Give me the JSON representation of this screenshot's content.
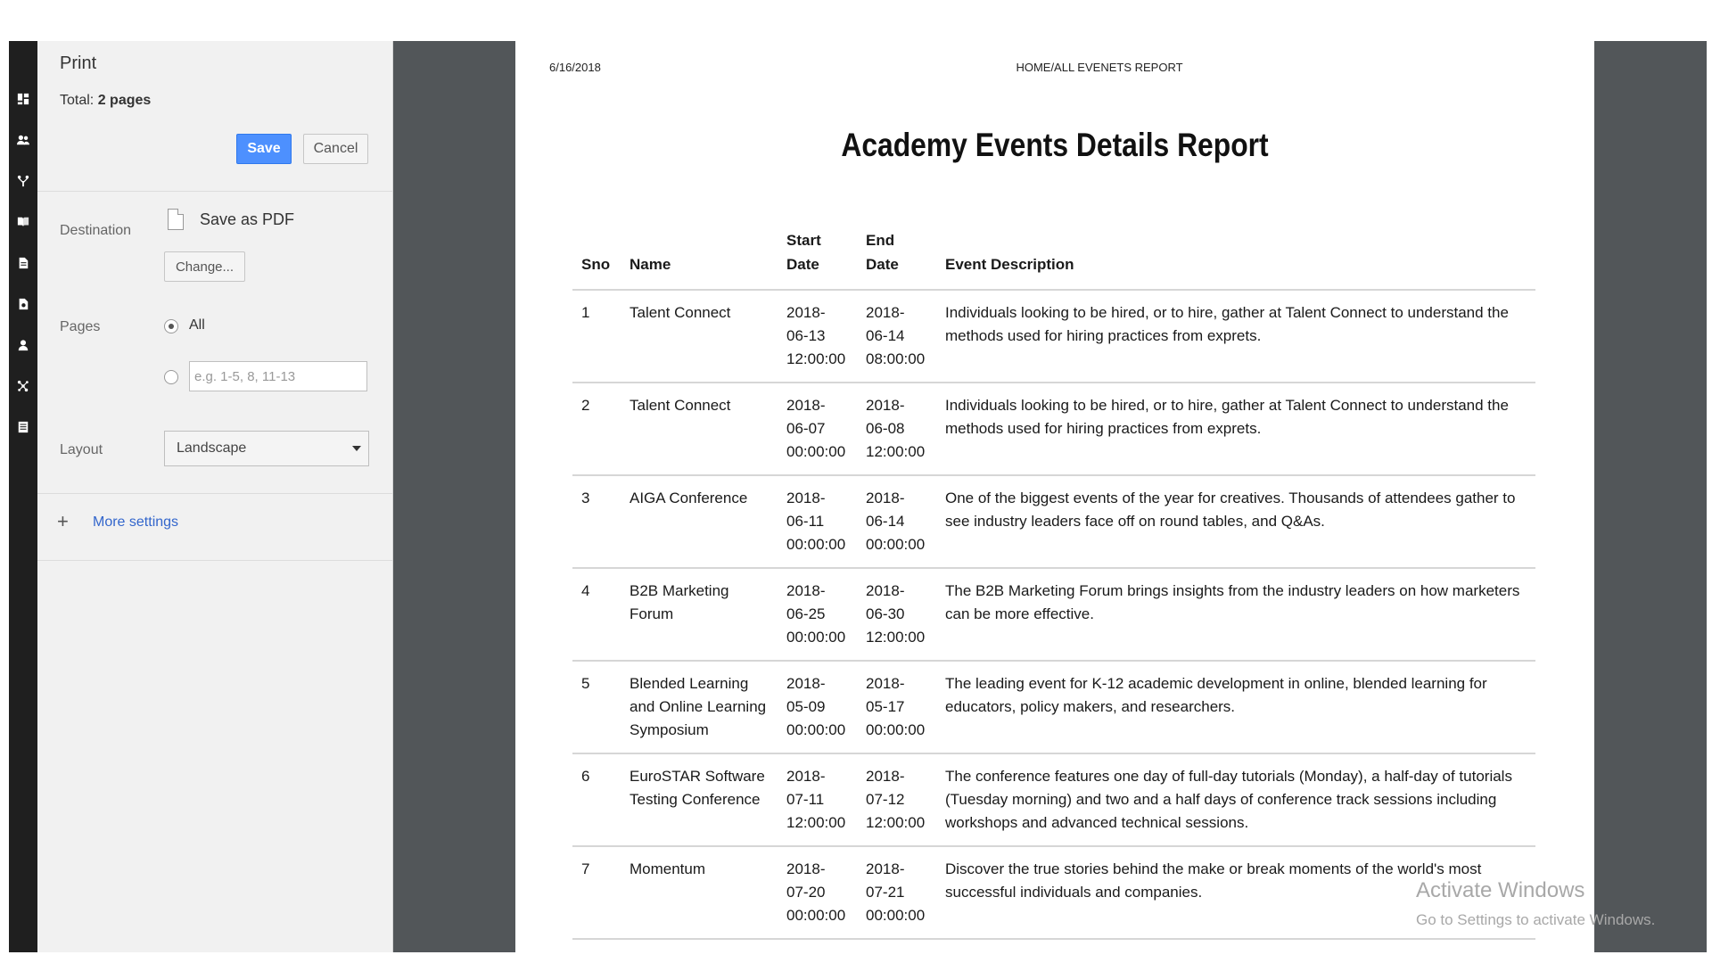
{
  "panel": {
    "title": "Print",
    "total_label": "Total:",
    "total_value": "2 pages",
    "save_label": "Save",
    "cancel_label": "Cancel",
    "destination_label": "Destination",
    "destination_value": "Save as PDF",
    "change_label": "Change...",
    "pages_label": "Pages",
    "pages_all_label": "All",
    "pages_placeholder": "e.g. 1-5, 8, 11-13",
    "layout_label": "Layout",
    "layout_value": "Landscape",
    "more_settings_label": "More settings"
  },
  "rail_icons": [
    "dashboard-icon",
    "users-icon",
    "branch-icon",
    "book-icon",
    "document-icon",
    "report-icon",
    "user-icon",
    "network-icon",
    "list-icon"
  ],
  "document": {
    "date": "6/16/2018",
    "header": "HOME/ALL EVENETS REPORT",
    "title": "Academy Events Details Report",
    "columns": {
      "sno": "Sno",
      "name": "Name",
      "start_line1": "Start",
      "start_line2": "Date",
      "end_line1": "End",
      "end_line2": "Date",
      "description": "Event Description"
    },
    "rows": [
      {
        "sno": "1",
        "name": "Talent Connect",
        "start": [
          "2018-",
          "06-13",
          "12:00:00"
        ],
        "end": [
          "2018-",
          "06-14",
          "08:00:00"
        ],
        "description": "Individuals looking to be hired, or to hire, gather at Talent Connect to understand the methods used for hiring practices from exprets."
      },
      {
        "sno": "2",
        "name": "Talent Connect",
        "start": [
          "2018-",
          "06-07",
          "00:00:00"
        ],
        "end": [
          "2018-",
          "06-08",
          "12:00:00"
        ],
        "description": "Individuals looking to be hired, or to hire, gather at Talent Connect to understand the methods used for hiring practices from exprets."
      },
      {
        "sno": "3",
        "name": "AIGA Conference",
        "start": [
          "2018-",
          "06-11",
          "00:00:00"
        ],
        "end": [
          "2018-",
          "06-14",
          "00:00:00"
        ],
        "description": "One of the biggest events of the year for creatives. Thousands of attendees gather to see industry leaders face off on round tables, and Q&As."
      },
      {
        "sno": "4",
        "name": "B2B Marketing Forum",
        "start": [
          "2018-",
          "06-25",
          "00:00:00"
        ],
        "end": [
          "2018-",
          "06-30",
          "12:00:00"
        ],
        "description": "The B2B Marketing Forum brings insights from the industry leaders on how marketers can be more effective."
      },
      {
        "sno": "5",
        "name": "Blended Learning and Online Learning Symposium",
        "start": [
          "2018-",
          "05-09",
          "00:00:00"
        ],
        "end": [
          "2018-",
          "05-17",
          "00:00:00"
        ],
        "description": "The leading event for K-12 academic development in online, blended learning for educators, policy makers, and researchers."
      },
      {
        "sno": "6",
        "name": "EuroSTAR Software Testing Conference",
        "start": [
          "2018-",
          "07-11",
          "12:00:00"
        ],
        "end": [
          "2018-",
          "07-12",
          "12:00:00"
        ],
        "description": "The conference features one day of full-day tutorials (Monday), a half-day of tutorials (Tuesday morning) and two and a half days of conference track sessions including workshops and advanced technical sessions."
      },
      {
        "sno": "7",
        "name": "Momentum",
        "start": [
          "2018-",
          "07-20",
          "00:00:00"
        ],
        "end": [
          "2018-",
          "07-21",
          "00:00:00"
        ],
        "description": "Discover the true stories behind the make or break moments of the world's most successful individuals and companies."
      }
    ]
  },
  "watermark": {
    "title": "Activate Windows",
    "subtitle": "Go to Settings to activate Windows."
  }
}
